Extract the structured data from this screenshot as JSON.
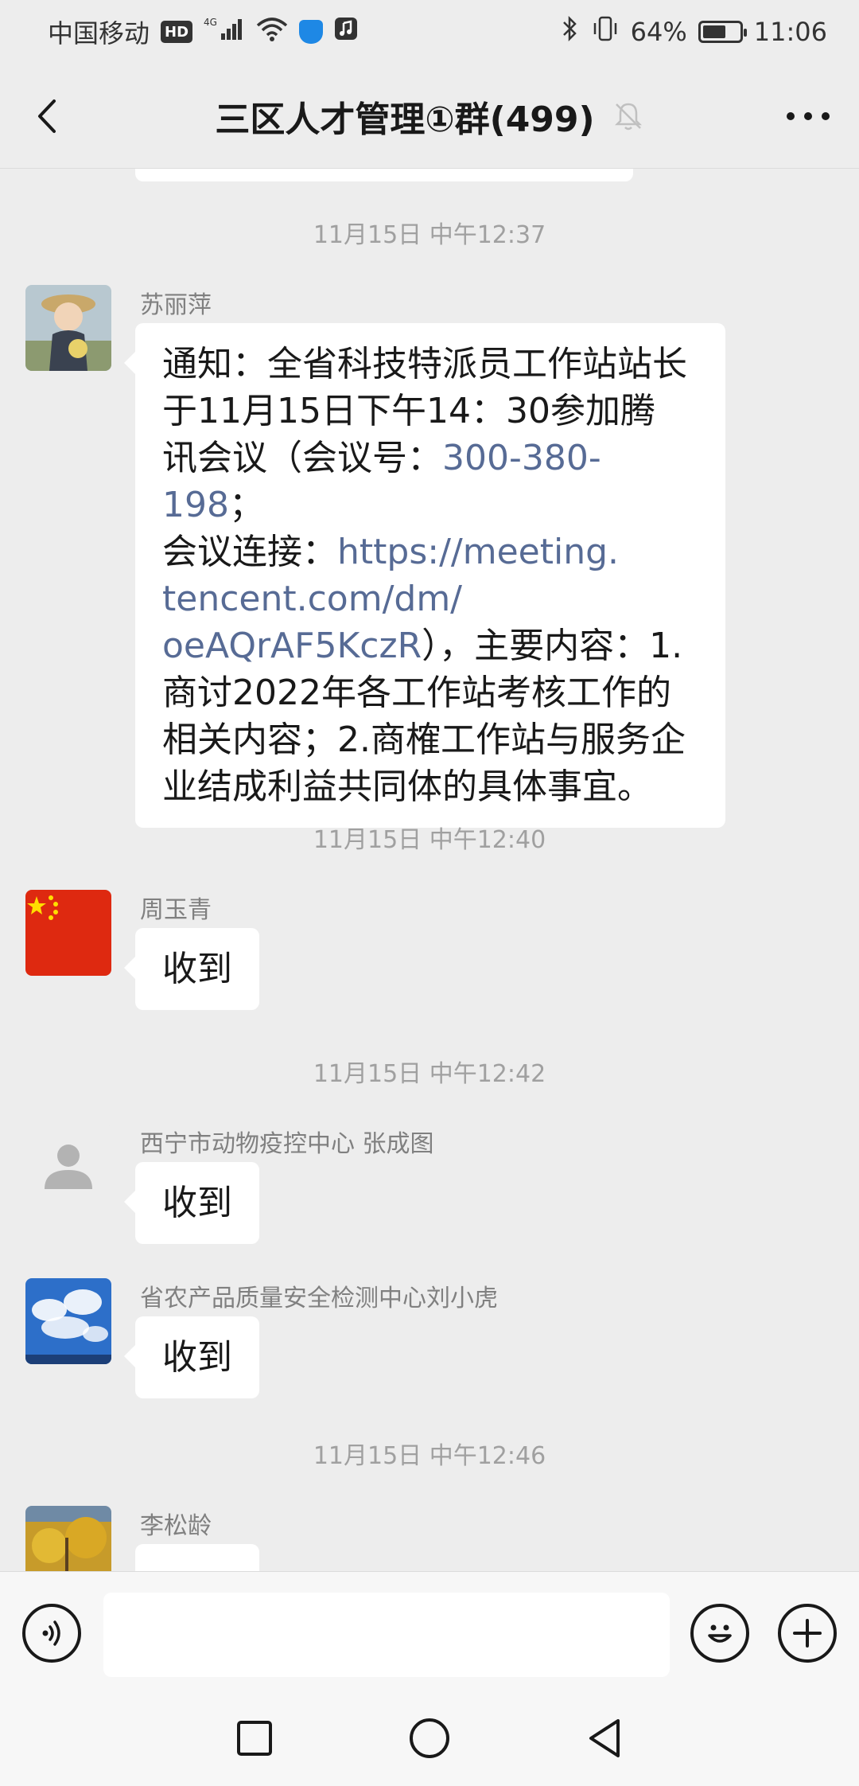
{
  "status_bar": {
    "carrier": "中国移动",
    "hd": "HD",
    "network": "4G",
    "battery": "64%",
    "battery_level": 0.64,
    "time": "11:06"
  },
  "header": {
    "title": "三区人才管理①群(499)",
    "back_icon": "chevron-left-icon",
    "mute_icon": "bell-off-icon",
    "more_icon": "more-dots-icon"
  },
  "messages": [
    {
      "time": "11月15日 中午12:37",
      "sender": "苏丽萍",
      "avatar": "child-photo",
      "lines": [
        {
          "text": "通知：全省科技特派员工作站站长"
        },
        {
          "text": "于11月15日下午14：30参加腾"
        },
        {
          "pre": "讯会议（会议号：",
          "link": "300-380-198",
          "post": "；"
        },
        {
          "pre": "会议连接：",
          "link": "https://meeting."
        },
        {
          "link": "tencent.com/dm/"
        },
        {
          "link": "oeAQrAF5KczR",
          "post": "），主要内容：1."
        },
        {
          "text": "商讨2022年各工作站考核工作的"
        },
        {
          "text": "相关内容；2.商榷工作站与服务企"
        },
        {
          "text": "业结成利益共同体的具体事宜。"
        }
      ]
    },
    {
      "time": "11月15日 中午12:40",
      "sender": "周玉青",
      "avatar": "flag-avatar",
      "text": "收到"
    },
    {
      "time": "11月15日 中午12:42",
      "sender": "西宁市动物疫控中心  张成图",
      "avatar": "default-person-avatar",
      "text": "收到"
    },
    {
      "sender": "省农产品质量安全检测中心刘小虎",
      "avatar": "sky-avatar",
      "text": "收到"
    },
    {
      "time": "11月15日 中午12:46",
      "sender": "李松龄",
      "avatar": "autumn-tree-avatar"
    }
  ],
  "input": {
    "placeholder": "",
    "voice_icon": "voice-icon",
    "emoji_icon": "emoji-icon",
    "plus_icon": "plus-icon"
  },
  "nav": {
    "recent_icon": "square-icon",
    "home_icon": "circle-icon",
    "back_icon": "triangle-back-icon"
  },
  "colors": {
    "background": "#ededed",
    "bubble": "#ffffff",
    "link": "#576b95",
    "timestamp": "#a0a0a0"
  }
}
